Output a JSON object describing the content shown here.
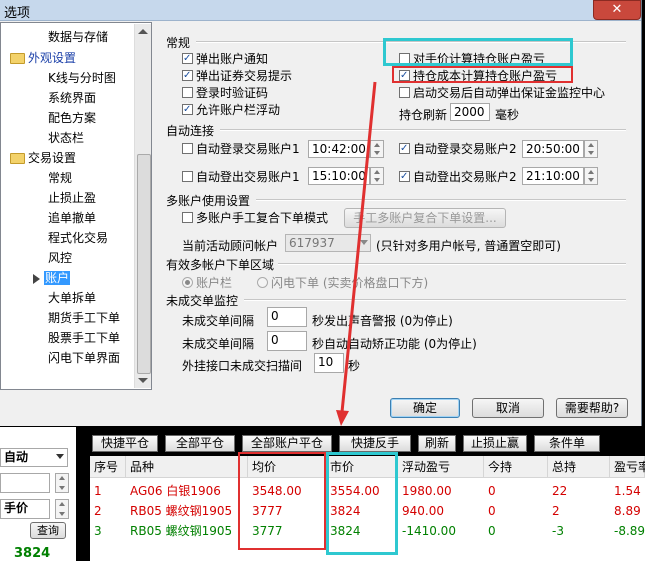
{
  "window": {
    "title": "选项",
    "close": "✕"
  },
  "tree": {
    "items": [
      {
        "label": "数据与存储"
      },
      {
        "label": "外观设置"
      },
      {
        "label": "K线与分时图"
      },
      {
        "label": "系统界面"
      },
      {
        "label": "配色方案"
      },
      {
        "label": "状态栏"
      },
      {
        "label": "交易设置"
      },
      {
        "label": "常规"
      },
      {
        "label": "止损止盈"
      },
      {
        "label": "追单撤单"
      },
      {
        "label": "程式化交易"
      },
      {
        "label": "风控"
      },
      {
        "label": "账户"
      },
      {
        "label": "大单拆单"
      },
      {
        "label": "期货手工下单"
      },
      {
        "label": "股票手工下单"
      },
      {
        "label": "闪电下单界面"
      }
    ]
  },
  "general": {
    "title": "常规",
    "popup_account_notice": "弹出账户通知",
    "popup_trade_prompt": "弹出证券交易提示",
    "login_captcha": "登录时验证码",
    "allow_float": "允许账户栏浮动",
    "manual_price_pnl": "对手价计算持仓账户盈亏",
    "cost_price_pnl": "持仓成本计算持仓账户盈亏",
    "auto_margin_monitor": "启动交易后自动弹出保证金监控中心",
    "refresh_label": "持仓刷新",
    "refresh_value": "2000",
    "refresh_unit": "毫秒"
  },
  "auto_connect": {
    "title": "自动连接",
    "login1": "自动登录交易账户1",
    "login1_time": "10:42:00",
    "login2": "自动登录交易账户2",
    "login2_time": "20:50:00",
    "logout1": "自动登出交易账户1",
    "logout1_time": "15:10:00",
    "logout2": "自动登出交易账户2",
    "logout2_time": "21:10:00"
  },
  "multi_account": {
    "title": "多账户使用设置",
    "manual_combine": "多账户手工复合下单模式",
    "combine_button": "手工多账户复合下单设置...",
    "active_label": "当前活动顾问帐户",
    "active_value": "617937",
    "active_note": "(只针对多用户帐号, 普通置空即可)"
  },
  "valid_area": {
    "title": "有效多帐户下单区域",
    "opt1": "账户栏",
    "opt2": "闪电下单 (实卖价格盘口下方)"
  },
  "unfilled": {
    "title": "未成交单监控",
    "interval1_label": "未成交单间隔",
    "interval1_value": "0",
    "interval1_note": "秒发出声音警报 (0为停止)",
    "interval2_label": "未成交单间隔",
    "interval2_value": "0",
    "interval2_note": "秒自动自动矫正功能 (0为停止)",
    "scan_label": "外挂接口未成交扫描间",
    "scan_value": "10",
    "scan_unit": "秒"
  },
  "dialog_buttons": {
    "ok": "确定",
    "cancel": "取消",
    "help": "需要帮助?"
  },
  "left_pane": {
    "mode": "自动",
    "price_type": "手价",
    "query": "查询",
    "price": "3824"
  },
  "toolbar": [
    "快捷平仓",
    "全部平仓",
    "全部账户平仓",
    "快捷反手",
    "刷新",
    "止损止赢",
    "条件单"
  ],
  "table": {
    "headers": [
      "序号",
      "品种",
      "均价",
      "市价",
      "浮动盈亏",
      "今持",
      "总持",
      "盈亏率"
    ],
    "rows": [
      [
        "1",
        "AG06 白银1906",
        "3548.00",
        "3554.00",
        "1980.00",
        "0",
        "22",
        "1.54"
      ],
      [
        "2",
        "RB05 螺纹钢1905",
        "3777",
        "3824",
        "940.00",
        "0",
        "2",
        "8.89"
      ],
      [
        "3",
        "RB05 螺纹钢1905",
        "3777",
        "3824",
        "-1410.00",
        "0",
        "-3",
        "-8.89"
      ]
    ]
  },
  "colors": {
    "accent": "#3399ff",
    "annotation_red": "#e03030",
    "annotation_cyan": "#2ec8d0",
    "row_red": "#d40000",
    "row_green": "#008000"
  }
}
